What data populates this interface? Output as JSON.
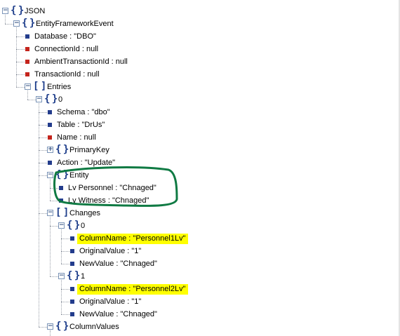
{
  "tree": {
    "nodes": [
      {
        "id": "json",
        "label": "JSON",
        "type": "object",
        "expanded": true,
        "level": 0,
        "interactable": true
      },
      {
        "id": "efe",
        "label": "EntityFrameworkEvent",
        "type": "object",
        "expanded": true,
        "level": 1
      },
      {
        "id": "database",
        "label": "Database : \"DBO\"",
        "type": "leaf",
        "color": "blue",
        "level": 2
      },
      {
        "id": "connection-id",
        "label": "ConnectionId : null",
        "type": "leaf",
        "color": "red",
        "level": 2
      },
      {
        "id": "ambient-transaction-id",
        "label": "AmbientTransactionId : null",
        "type": "leaf",
        "color": "red",
        "level": 2
      },
      {
        "id": "transaction-id",
        "label": "TransactionId : null",
        "type": "leaf",
        "color": "red",
        "level": 2
      },
      {
        "id": "entries",
        "label": "Entries",
        "type": "array",
        "expanded": true,
        "level": 2
      },
      {
        "id": "entry-0",
        "label": "0",
        "type": "object",
        "expanded": true,
        "level": 3
      },
      {
        "id": "schema",
        "label": "Schema : \"dbo\"",
        "type": "leaf",
        "color": "blue",
        "level": 4
      },
      {
        "id": "table",
        "label": "Table : \"DrUs\"",
        "type": "leaf",
        "color": "blue",
        "level": 4
      },
      {
        "id": "name",
        "label": "Name : null",
        "type": "leaf",
        "color": "red",
        "level": 4
      },
      {
        "id": "primary-key",
        "label": "PrimaryKey",
        "type": "object",
        "expanded": false,
        "level": 4
      },
      {
        "id": "action",
        "label": "Action : \"Update\"",
        "type": "leaf",
        "color": "blue",
        "level": 4
      },
      {
        "id": "entity",
        "label": "Entity",
        "type": "object",
        "expanded": true,
        "level": 4
      },
      {
        "id": "lv-personnel",
        "label": "Lv Personnel : \"Chnaged\"",
        "type": "leaf",
        "color": "blue",
        "level": 5
      },
      {
        "id": "lv-witness",
        "label": "Lv Witness : \"Chnaged\"",
        "type": "leaf",
        "color": "blue",
        "level": 5
      },
      {
        "id": "changes",
        "label": "Changes",
        "type": "array",
        "expanded": true,
        "level": 4
      },
      {
        "id": "change-0",
        "label": "0",
        "type": "object",
        "expanded": true,
        "level": 5
      },
      {
        "id": "change-0-column",
        "label": "ColumnName : \"Personnel1Lv\"",
        "type": "leaf",
        "color": "blue",
        "level": 6,
        "highlight": true
      },
      {
        "id": "change-0-original",
        "label": "OriginalValue : \"1\"",
        "type": "leaf",
        "color": "blue",
        "level": 6
      },
      {
        "id": "change-0-new",
        "label": "NewValue : \"Chnaged\"",
        "type": "leaf",
        "color": "blue",
        "level": 6
      },
      {
        "id": "change-1",
        "label": "1",
        "type": "object",
        "expanded": true,
        "level": 5
      },
      {
        "id": "change-1-column",
        "label": "ColumnName : \"Personnel2Lv\"",
        "type": "leaf",
        "color": "blue",
        "level": 6,
        "highlight": true
      },
      {
        "id": "change-1-original",
        "label": "OriginalValue : \"1\"",
        "type": "leaf",
        "color": "blue",
        "level": 6
      },
      {
        "id": "change-1-new",
        "label": "NewValue : \"Chnaged\"",
        "type": "leaf",
        "color": "blue",
        "level": 6
      },
      {
        "id": "column-values",
        "label": "ColumnValues",
        "type": "object",
        "expanded": true,
        "level": 4
      }
    ]
  },
  "colors": {
    "leaf_blue": "#233c8c",
    "leaf_red": "#c4241c",
    "brace": "#1c3c8a",
    "highlight": "#ffff00",
    "annotation": "#0f7a43"
  },
  "icons": {
    "expanded": "minus-box-icon",
    "collapsed": "plus-box-icon",
    "object": "curly-braces-icon",
    "array": "square-brackets-icon",
    "leaf": "square-bullet-icon"
  }
}
